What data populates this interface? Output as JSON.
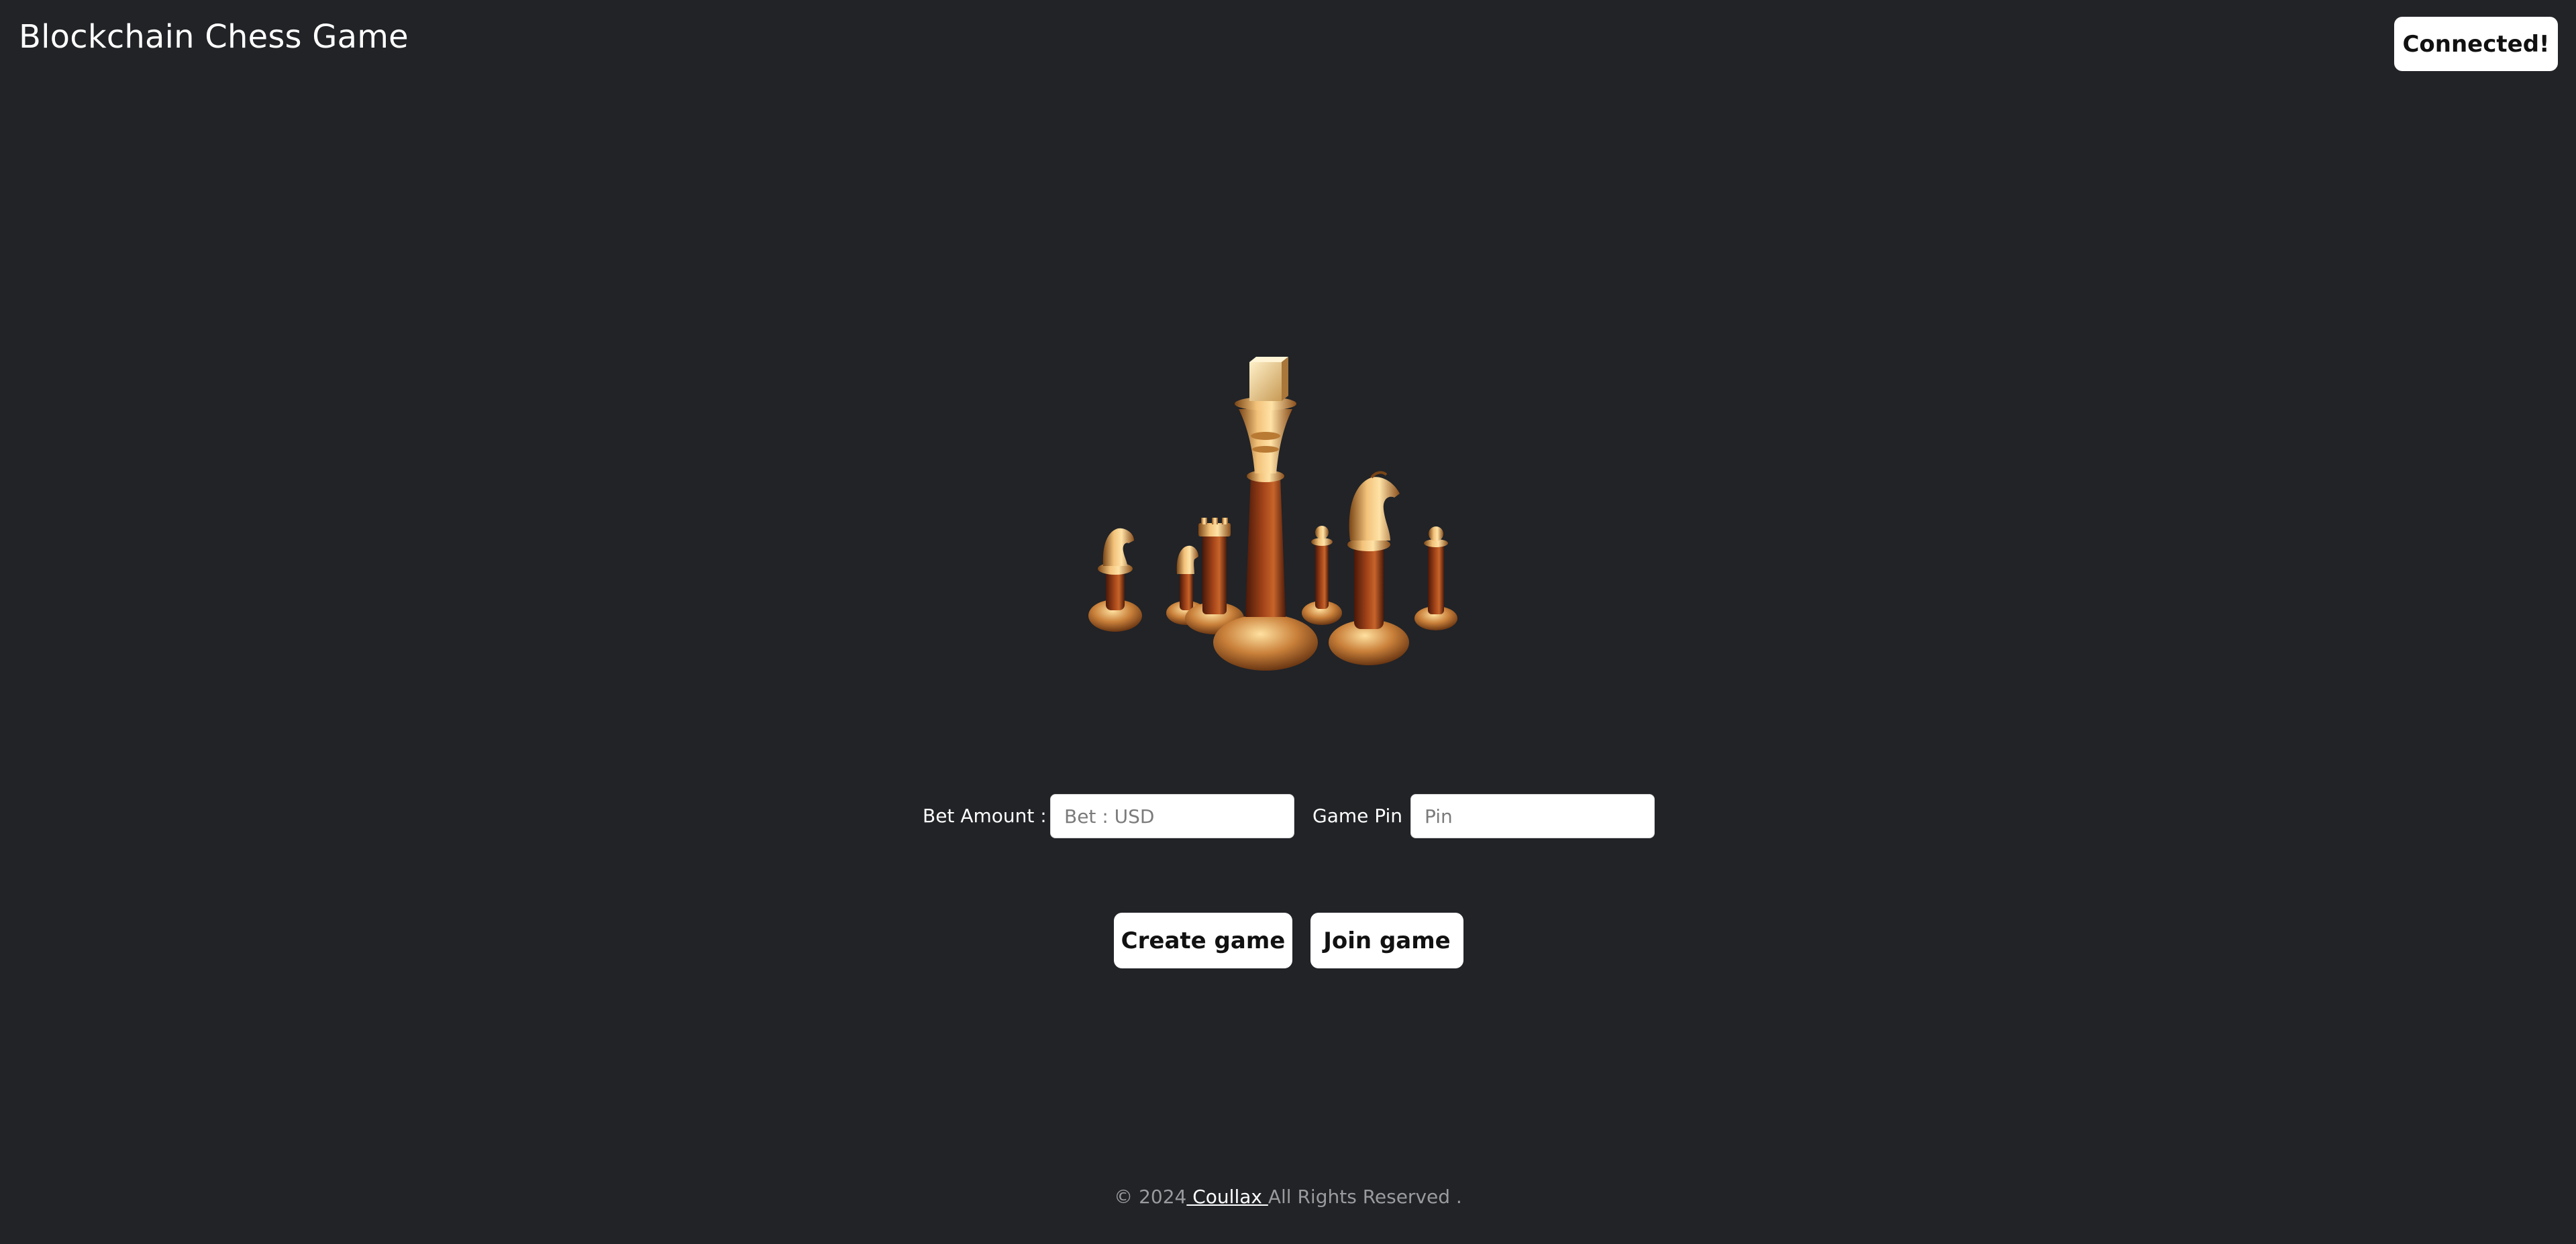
{
  "header": {
    "title": "Blockchain Chess Game",
    "connect_label": "Connected!"
  },
  "hero": {
    "image_name": "chess-pieces-image"
  },
  "form": {
    "bet_label": "Bet Amount :",
    "bet_placeholder": "Bet : USD",
    "bet_value": "",
    "pin_label": "Game Pin",
    "pin_placeholder": "Pin",
    "pin_value": ""
  },
  "actions": {
    "create_label": "Create game",
    "join_label": "Join game"
  },
  "footer": {
    "prefix": "© 2024",
    "link_text": " Coullax ",
    "suffix": "All Rights Reserved ."
  },
  "colors": {
    "background": "#212327",
    "button_bg": "#ffffff",
    "gold": "#d9a15a",
    "wood": "#8a3a16"
  }
}
